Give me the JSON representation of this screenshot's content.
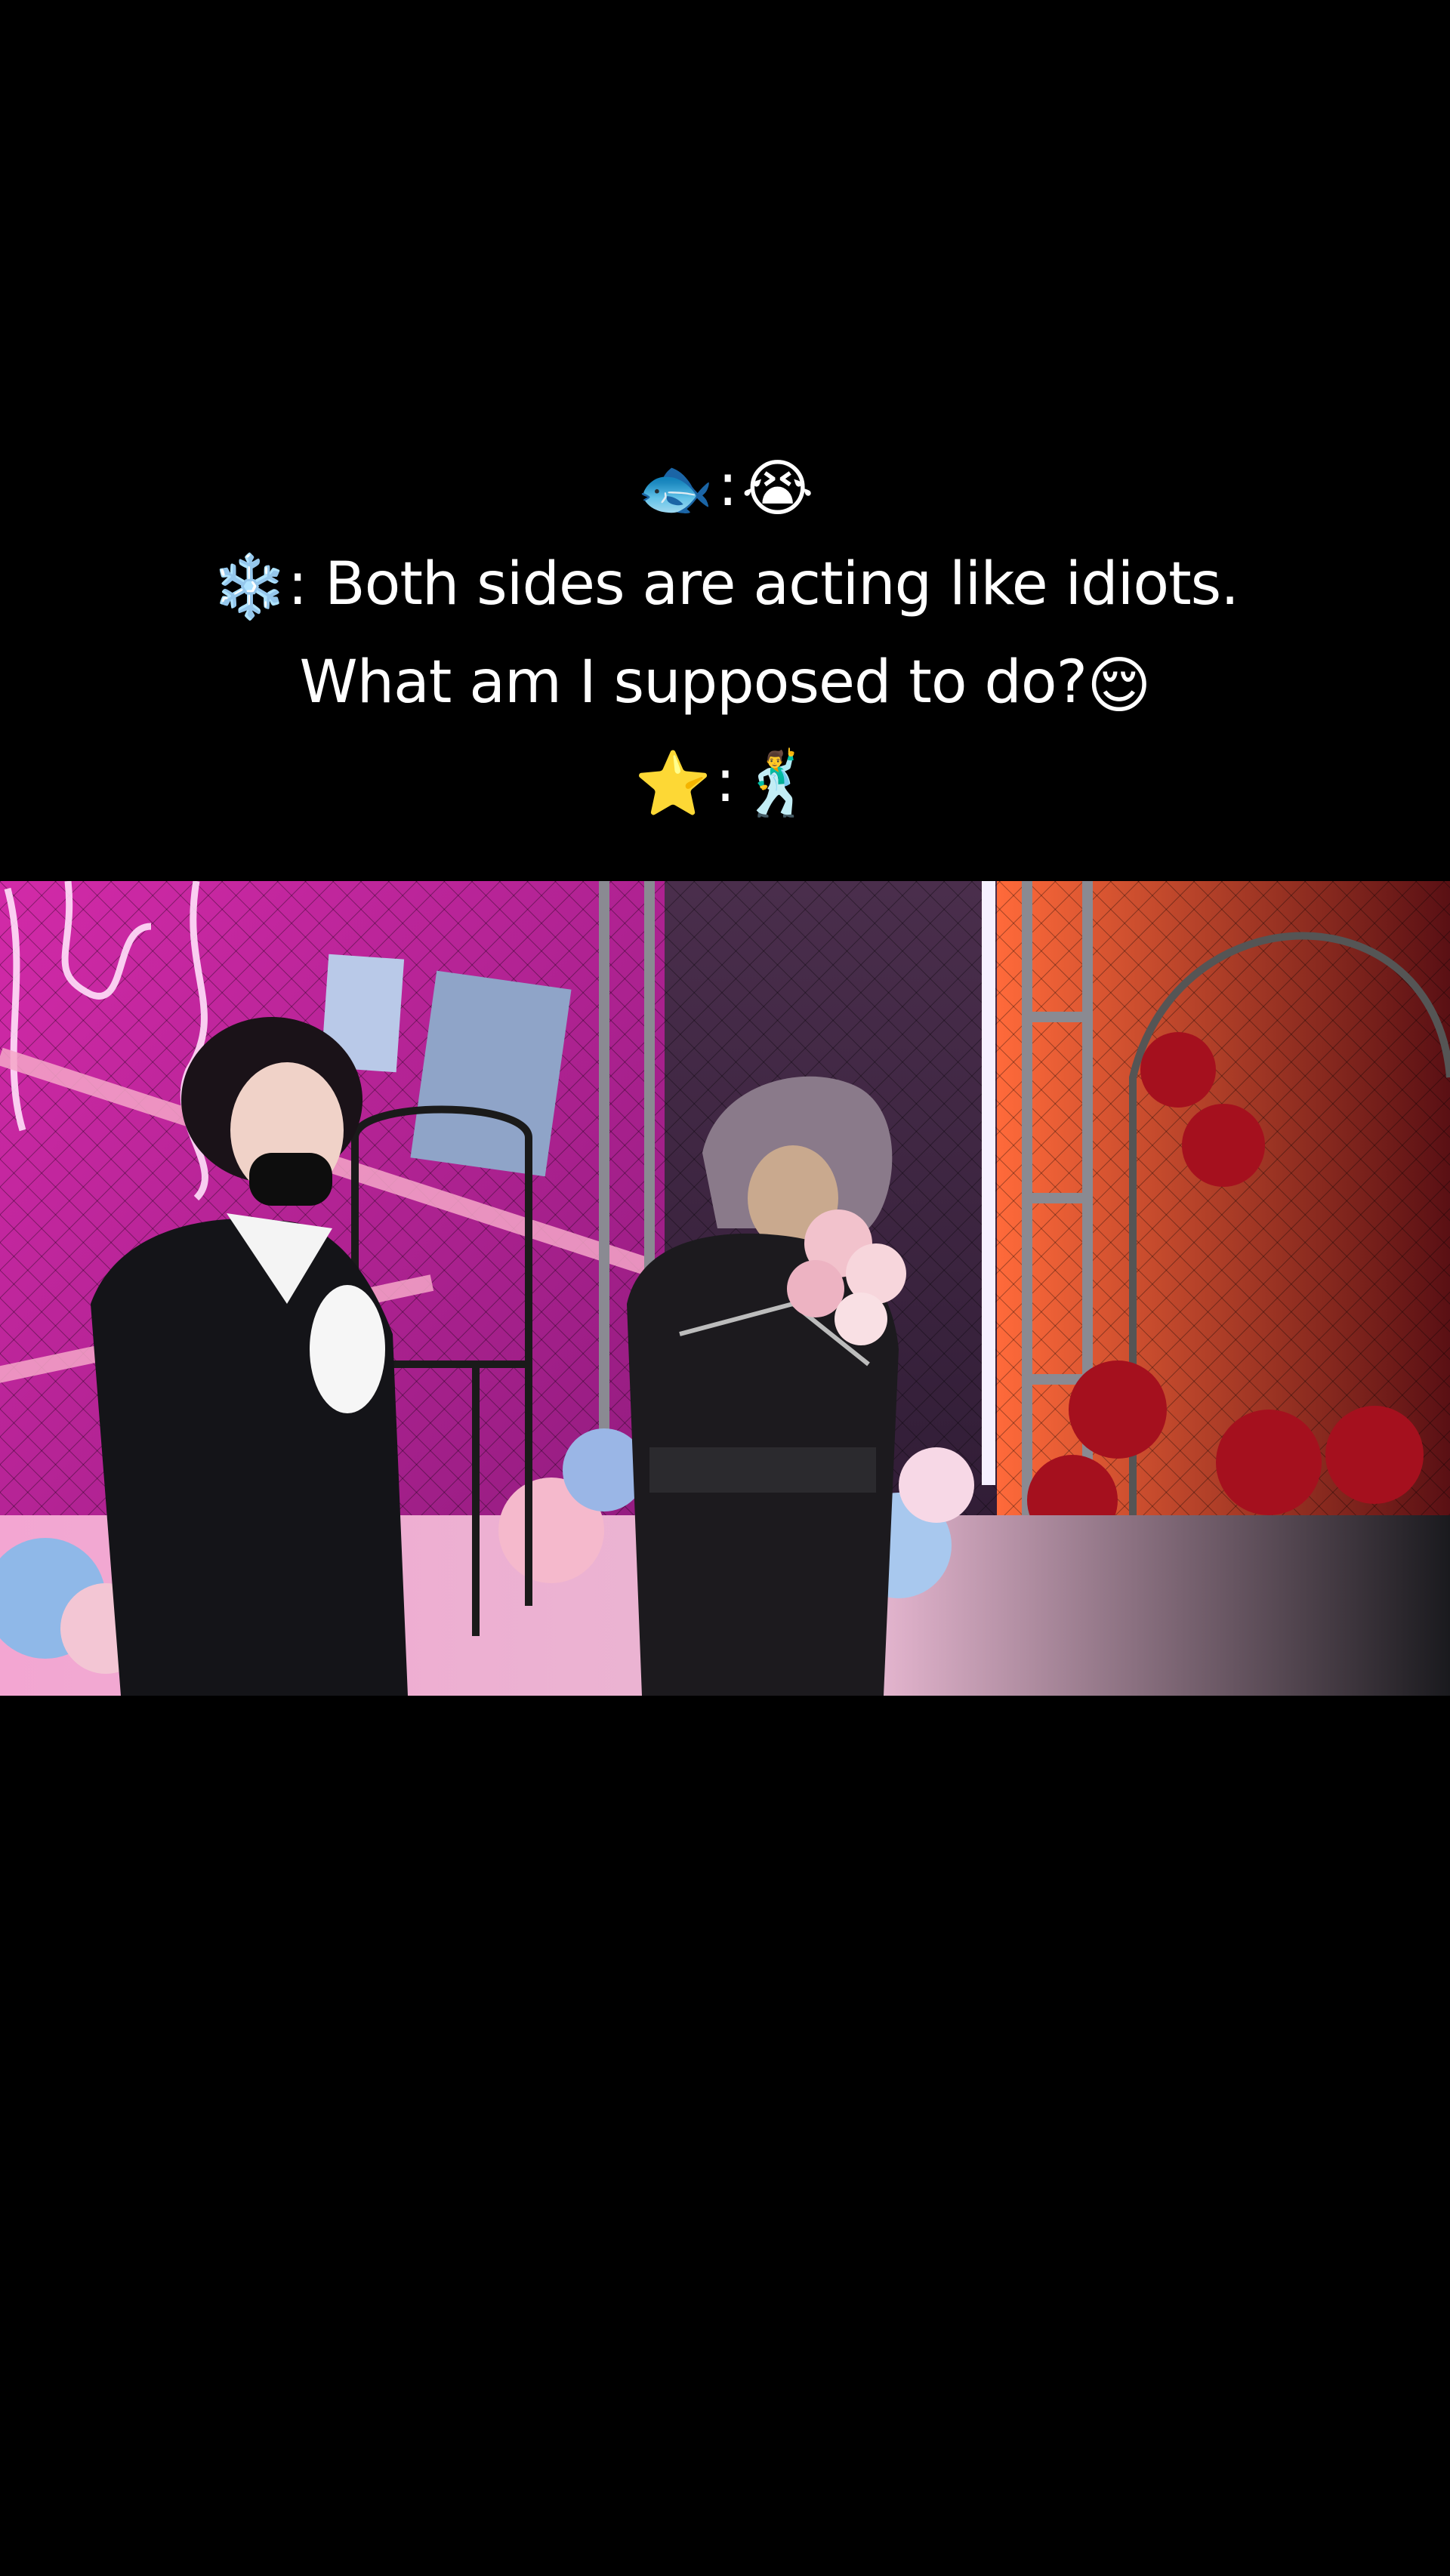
{
  "caption": {
    "line1": {
      "emoji_a": "🐟",
      "sep": ":",
      "emoji_b": "😭"
    },
    "line2": {
      "emoji": "❄️",
      "text": ": Both sides are acting like idiots."
    },
    "line3": {
      "text": "What am I supposed to do?",
      "emoji": "😌"
    },
    "line4": {
      "emoji_a": "⭐",
      "sep": ":",
      "emoji_b": "🕺"
    }
  },
  "video": {
    "colors": {
      "left_wall": "#c0209a",
      "neon": "#ffd6f6",
      "right_wall": "#b8262a",
      "center_wall": "#3a1f3a",
      "floor": "#f0b7d4"
    }
  }
}
